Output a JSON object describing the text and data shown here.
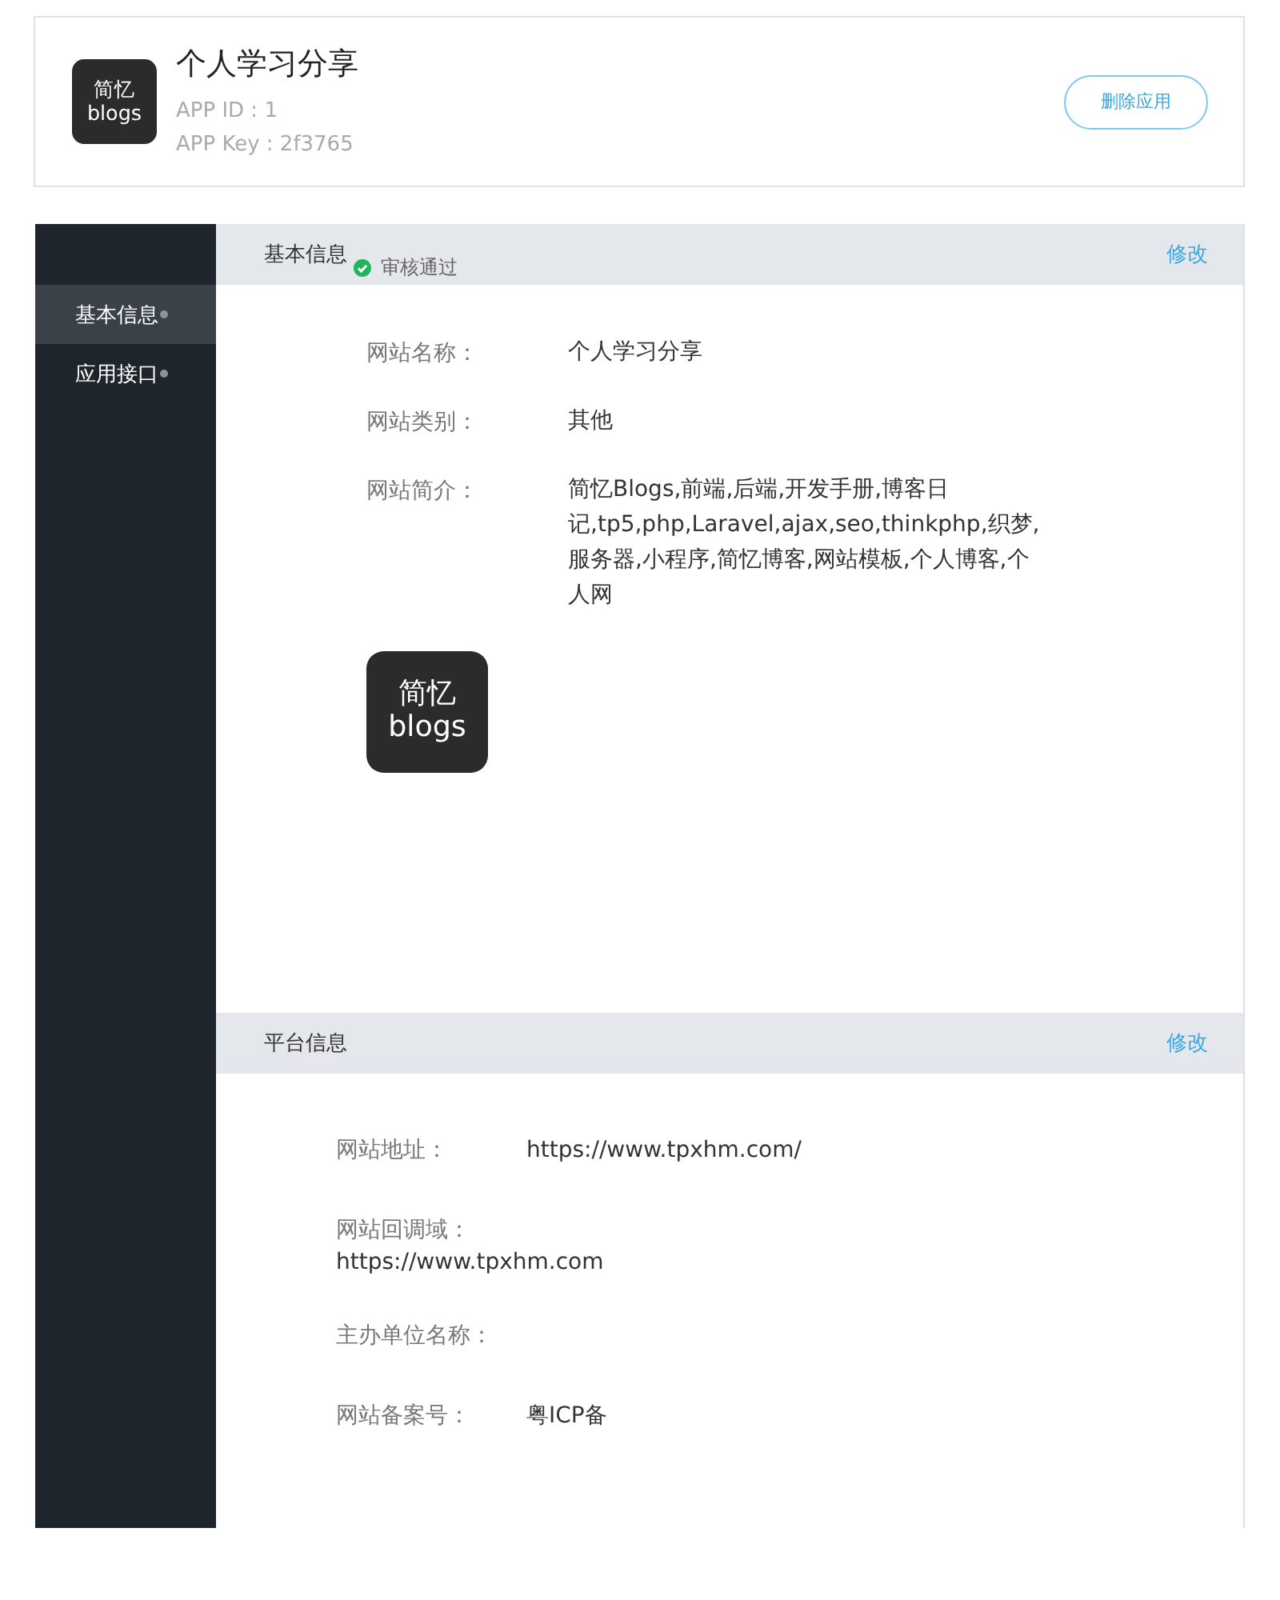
{
  "app_header": {
    "logo": {
      "line1": "简忆",
      "line2": "blogs"
    },
    "title": "个人学习分享",
    "app_id": "APP ID : 1",
    "app_key": "APP Key : 2f3765",
    "delete_button": "删除应用"
  },
  "sidebar": {
    "items": [
      {
        "label": "基本信息",
        "selected": true
      },
      {
        "label": "应用接口",
        "selected": false
      }
    ]
  },
  "basic_info": {
    "title": "基本信息",
    "status": "审核通过",
    "approved": true,
    "edit_link": "修改",
    "fields": [
      {
        "label": "网站名称：",
        "value": "个人学习分享"
      },
      {
        "label": "网站类别：",
        "value": "其他"
      },
      {
        "label": "网站简介：",
        "value": "简忆Blogs,前端,后端,开发手册,博客日记,tp5,php,Laravel,ajax,seo,thinkphp,织梦,服务器,小程序,简忆博客,网站模板,个人博客,个人网"
      }
    ],
    "logo": {
      "line1": "简忆",
      "line2": "blogs"
    }
  },
  "platform_info": {
    "title": "平台信息",
    "edit_link": "修改",
    "fields": [
      {
        "label": "网站地址：",
        "value": "https://www.tpxhm.com/",
        "kind": "inline"
      },
      {
        "label": "网站回调域：",
        "value": "https://www.tpxhm.com",
        "kind": "stacked"
      },
      {
        "label": "主办单位名称：",
        "kind": "inline"
      },
      {
        "label": "网站备案号：",
        "value": "粤ICP备",
        "kind": "inline"
      }
    ]
  }
}
